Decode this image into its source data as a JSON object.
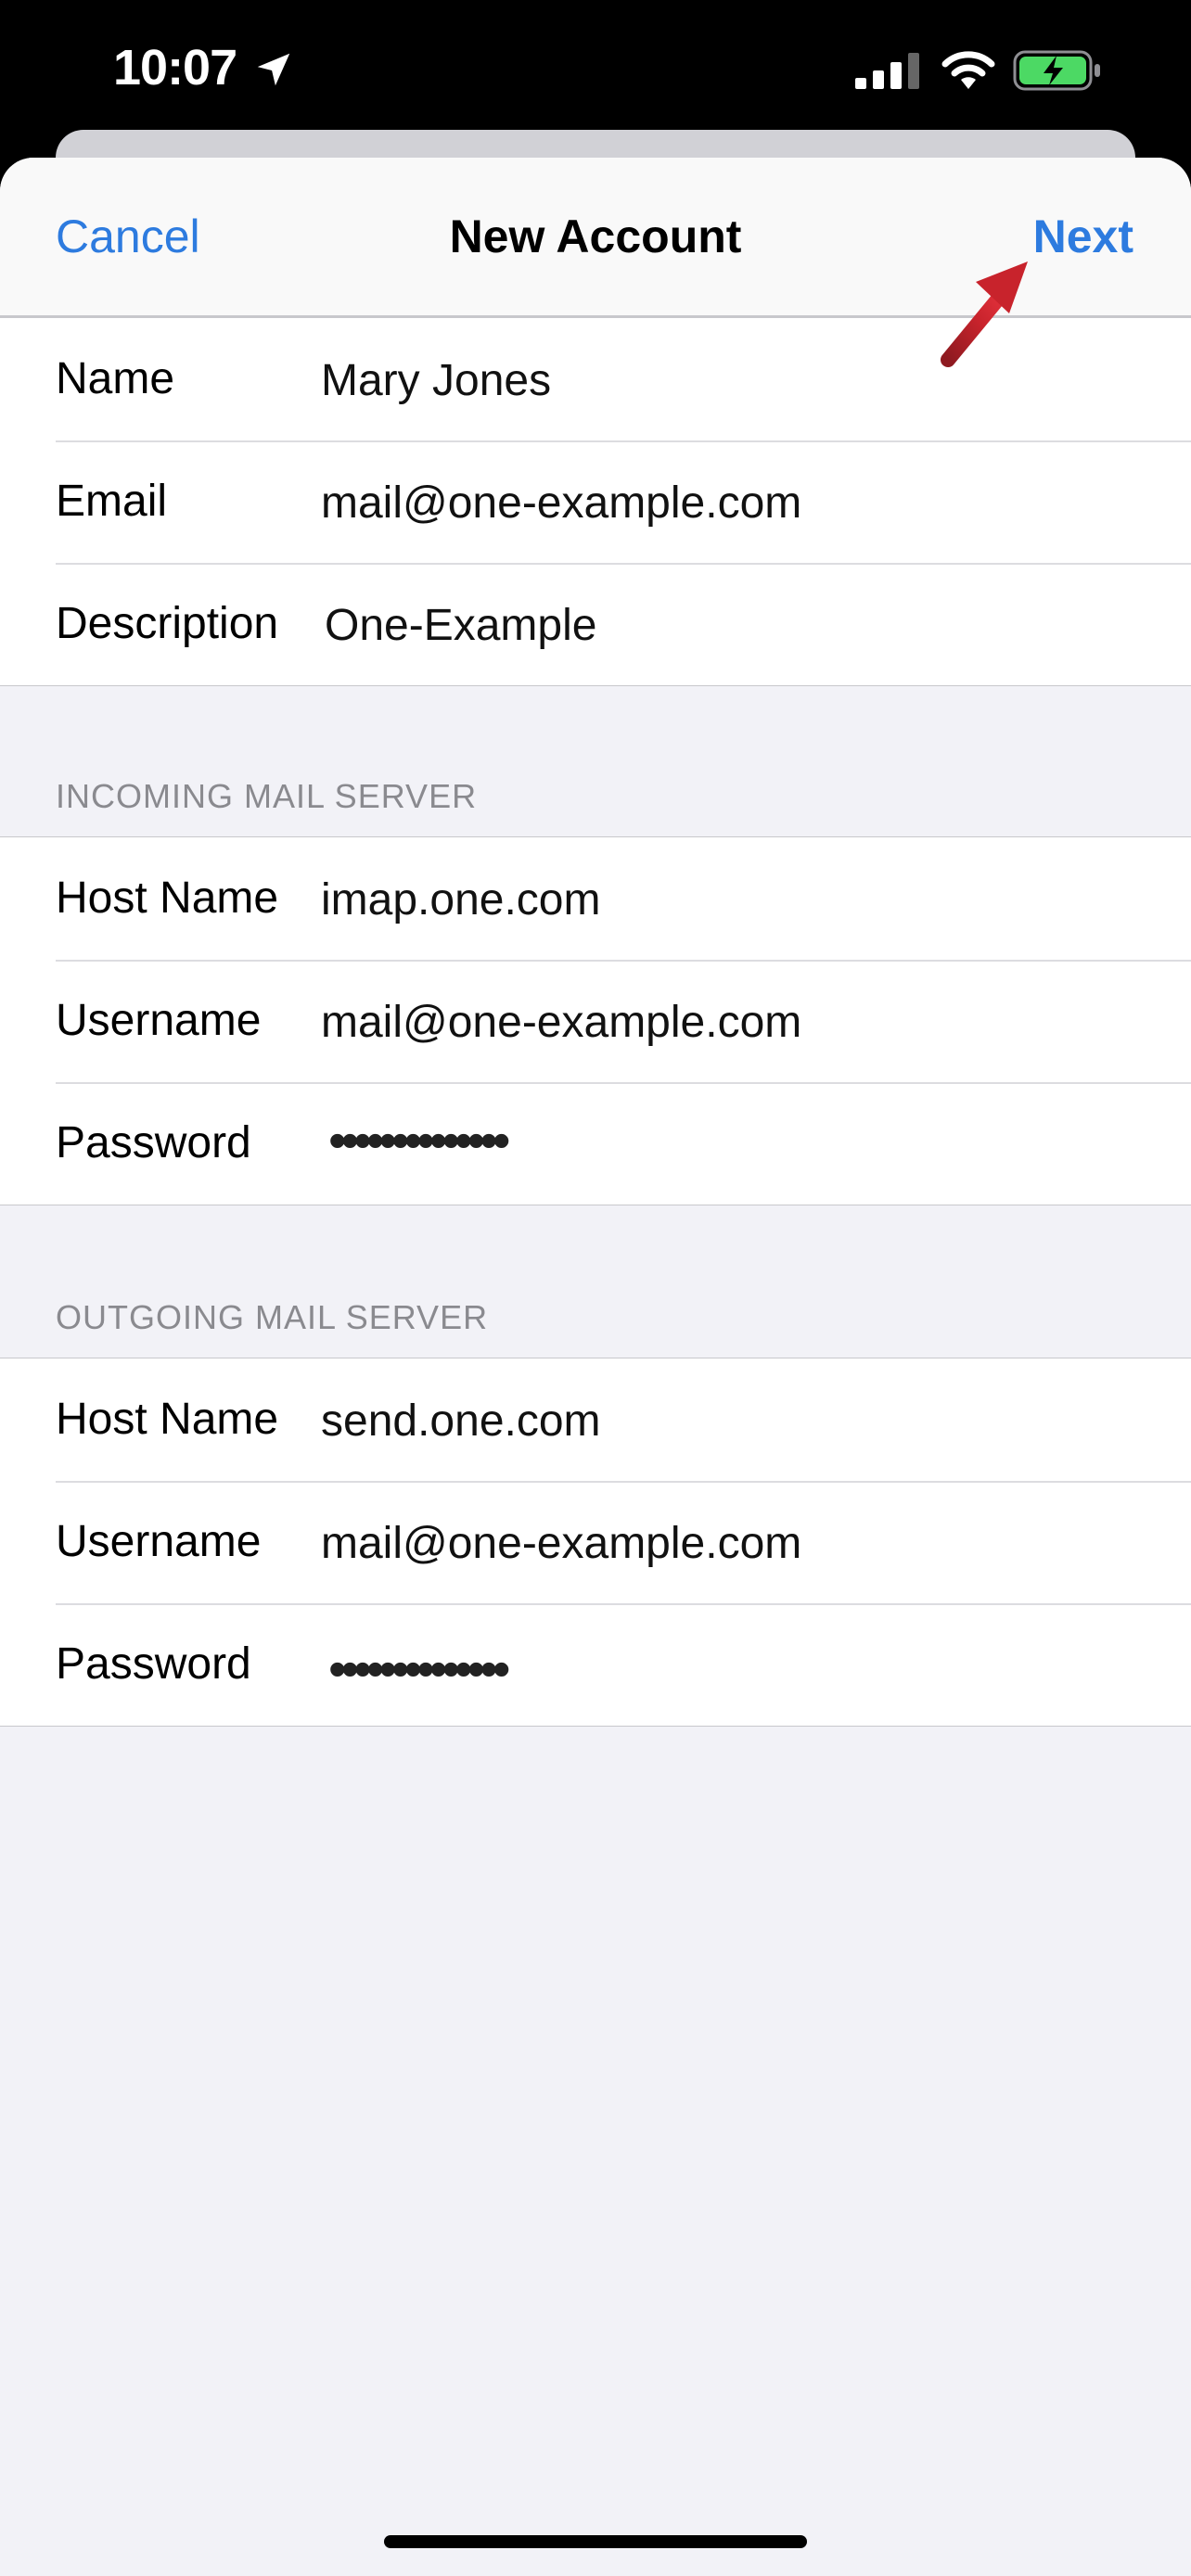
{
  "status_bar": {
    "time": "10:07",
    "icons": [
      "location-arrow-icon",
      "cellular-signal-icon",
      "wifi-icon",
      "battery-charging-icon"
    ]
  },
  "navbar": {
    "cancel_label": "Cancel",
    "title": "New Account",
    "next_label": "Next"
  },
  "account": {
    "rows": [
      {
        "label": "Name",
        "value": "Mary Jones"
      },
      {
        "label": "Email",
        "value": "mail@one-example.com"
      },
      {
        "label": "Description",
        "value": "One-Example"
      }
    ]
  },
  "incoming": {
    "header": "INCOMING MAIL SERVER",
    "rows": [
      {
        "label": "Host Name",
        "value": "imap.one.com"
      },
      {
        "label": "Username",
        "value": "mail@one-example.com"
      },
      {
        "label": "Password",
        "value": "••••••••••••••"
      }
    ]
  },
  "outgoing": {
    "header": "OUTGOING MAIL SERVER",
    "rows": [
      {
        "label": "Host Name",
        "value": "send.one.com"
      },
      {
        "label": "Username",
        "value": "mail@one-example.com"
      },
      {
        "label": "Password",
        "value": "••••••••••••••"
      }
    ]
  },
  "colors": {
    "accent": "#2d7bdf",
    "annotation_arrow": "#c8232c",
    "battery": "#4cd964"
  }
}
